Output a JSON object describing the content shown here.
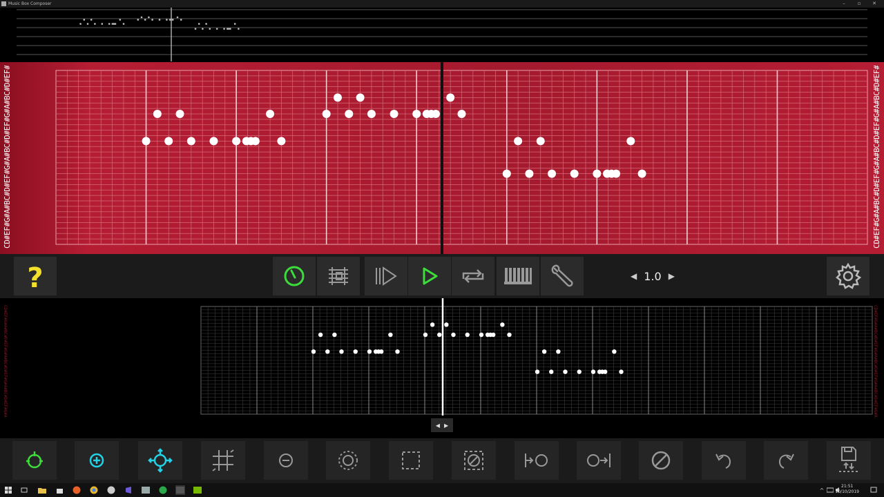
{
  "window": {
    "title": "Music Box Composer"
  },
  "roll": {
    "note_labels": "CD#EF#G#A#BC#D#EF#G#A#BC#D#EF#G#A#BC#D#EF#G#A",
    "notes_main": [
      {
        "t": 8,
        "r": 13
      },
      {
        "t": 9,
        "r": 8
      },
      {
        "t": 10,
        "r": 13
      },
      {
        "t": 11,
        "r": 8
      },
      {
        "t": 12,
        "r": 13
      },
      {
        "t": 14,
        "r": 13
      },
      {
        "t": 16,
        "r": 13
      },
      {
        "t": 16.9,
        "r": 13
      },
      {
        "t": 17.3,
        "r": 13
      },
      {
        "t": 17.7,
        "r": 13
      },
      {
        "t": 19,
        "r": 8
      },
      {
        "t": 20,
        "r": 13
      },
      {
        "t": 24,
        "r": 8
      },
      {
        "t": 25,
        "r": 5
      },
      {
        "t": 26,
        "r": 8
      },
      {
        "t": 27,
        "r": 5
      },
      {
        "t": 28,
        "r": 8
      },
      {
        "t": 30,
        "r": 8
      },
      {
        "t": 32,
        "r": 8
      },
      {
        "t": 32.9,
        "r": 8
      },
      {
        "t": 33.3,
        "r": 8
      },
      {
        "t": 33.7,
        "r": 8
      },
      {
        "t": 35,
        "r": 5
      },
      {
        "t": 36,
        "r": 8
      },
      {
        "t": 40,
        "r": 19
      },
      {
        "t": 41,
        "r": 13
      },
      {
        "t": 42,
        "r": 19
      },
      {
        "t": 43,
        "r": 13
      },
      {
        "t": 44,
        "r": 19
      },
      {
        "t": 46,
        "r": 19
      },
      {
        "t": 48,
        "r": 19
      },
      {
        "t": 48.9,
        "r": 19
      },
      {
        "t": 49.3,
        "r": 19
      },
      {
        "t": 49.7,
        "r": 19
      },
      {
        "t": 51,
        "r": 13
      },
      {
        "t": 52,
        "r": 19
      }
    ]
  },
  "toolbar_top": {
    "help_icon": "question-icon",
    "speed_value": "1.0",
    "buttons": [
      "metronome-icon",
      "measure-icon",
      "play-from-icon",
      "play-icon",
      "loop-icon",
      "piano-icon",
      "wrench-icon"
    ],
    "settings_icon": "gear-icon"
  },
  "toolbar_bottom": {
    "buttons": [
      "add-loop-icon",
      "add-note-icon",
      "move-icon",
      "grid-icon",
      "remove-icon",
      "select-circle-icon",
      "select-rect-icon",
      "clear-selection-icon",
      "shift-left-icon",
      "shift-right-icon",
      "disable-icon",
      "undo-icon",
      "redo-icon",
      "save-icon"
    ]
  },
  "taskbar": {
    "time": "21:51",
    "date": "10/10/2019"
  },
  "colors": {
    "accent_green": "#3ddc3d",
    "accent_cyan": "#22d3e8",
    "help_yellow": "#f2e02a",
    "roll_red": "#a51a2e"
  }
}
